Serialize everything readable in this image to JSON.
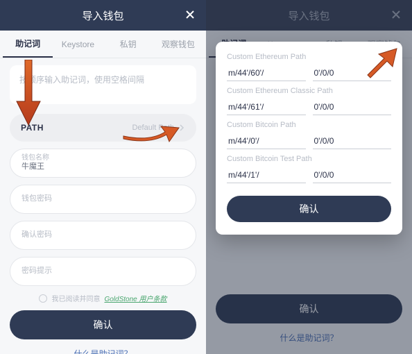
{
  "header": {
    "title": "导入钱包"
  },
  "tabs": {
    "t0": "助记词",
    "t1": "Keystore",
    "t2": "私钥",
    "t3": "观察钱包"
  },
  "mnemonic": {
    "placeholder": "按顺序输入助记词，使用空格间隔"
  },
  "path": {
    "label": "PATH",
    "default": "Default Path"
  },
  "fields": {
    "name_label": "钱包名称",
    "name_value": "牛魔王",
    "pwd_label": "钱包密码",
    "pwd2_label": "确认密码",
    "hint_label": "密码提示"
  },
  "terms": {
    "prefix": "我已阅读并同意",
    "link": "GoldStone 用户条款"
  },
  "confirm": "确认",
  "footer": "什么是助记词？",
  "modal": {
    "groups": [
      {
        "label": "Custom Ethereum Path",
        "prefix": "m/44'/60'/",
        "suffix": "0'/0/0"
      },
      {
        "label": "Custom Ethereum Classic Path",
        "prefix": "m/44'/61'/",
        "suffix": "0'/0/0"
      },
      {
        "label": "Custom Bitcoin Path",
        "prefix": "m/44'/0'/",
        "suffix": "0'/0/0"
      },
      {
        "label": "Custom Bitcoin Test Path",
        "prefix": "m/44'/1'/",
        "suffix": "0'/0/0"
      }
    ],
    "confirm": "确认"
  }
}
